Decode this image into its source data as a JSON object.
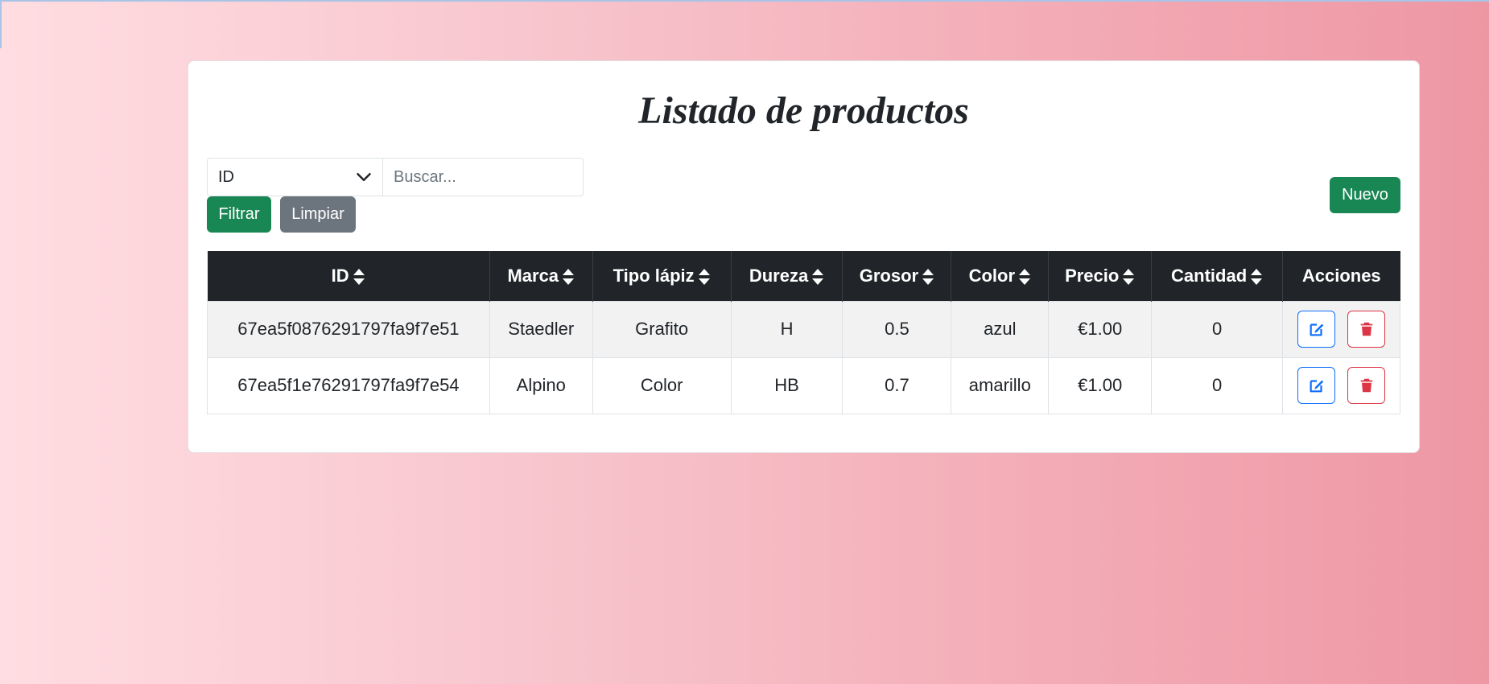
{
  "page": {
    "title": "Listado de productos"
  },
  "filter": {
    "field_selected": "ID",
    "search_placeholder": "Buscar...",
    "filter_label": "Filtrar",
    "clear_label": "Limpiar"
  },
  "toolbar": {
    "new_label": "Nuevo"
  },
  "table": {
    "headers": [
      "ID",
      "Marca",
      "Tipo lápiz",
      "Dureza",
      "Grosor",
      "Color",
      "Precio",
      "Cantidad",
      "Acciones"
    ],
    "rows": [
      [
        "67ea5f0876291797fa9f7e51",
        "Staedler",
        "Grafito",
        "H",
        "0.5",
        "azul",
        "€1.00",
        "0"
      ],
      [
        "67ea5f1e76291797fa9f7e54",
        "Alpino",
        "Color",
        "HB",
        "0.7",
        "amarillo",
        "€1.00",
        "0"
      ]
    ]
  },
  "colors": {
    "primary": "#0d6efd",
    "success": "#198754",
    "secondary": "#6c757d",
    "danger": "#dc3545",
    "table_header": "#212529"
  },
  "icons": {
    "sort": "sort-icon",
    "edit": "edit-icon",
    "delete": "trash-icon",
    "dropdown": "chevron-down-icon"
  }
}
